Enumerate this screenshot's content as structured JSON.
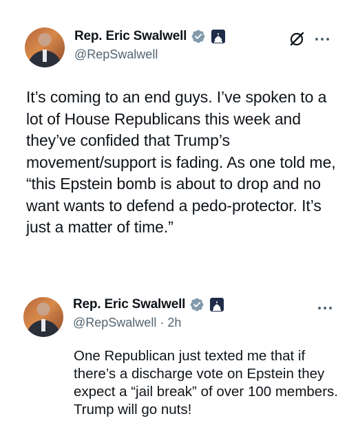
{
  "main_tweet": {
    "display_name": "Rep. Eric Swalwell",
    "handle": "@RepSwalwell",
    "text": "It’s coming to an end guys. I’ve spoken to a lot of House Republicans this week and they’ve confided that Trump’s movement/support is fading. As one told me, “this Epstein bomb is about to drop and no want wants to defend a pedo-protector. It’s just a matter of time.”"
  },
  "quoted_tweet": {
    "display_name": "Rep. Eric Swalwell",
    "handle": "@RepSwalwell",
    "separator": "·",
    "time": "2h",
    "text": "One Republican just texted me that if there’s a discharge vote on Epstein they expect a “jail break” of over 100 members.  Trump will go nuts!"
  },
  "colors": {
    "verified_badge": "#829aab",
    "gov_badge": "#1f2d4a",
    "secondary_text": "#536471",
    "primary_text": "#0f1419"
  },
  "icons": [
    "verified-badge-icon",
    "government-badge-icon",
    "grok-icon",
    "more-options-icon"
  ]
}
